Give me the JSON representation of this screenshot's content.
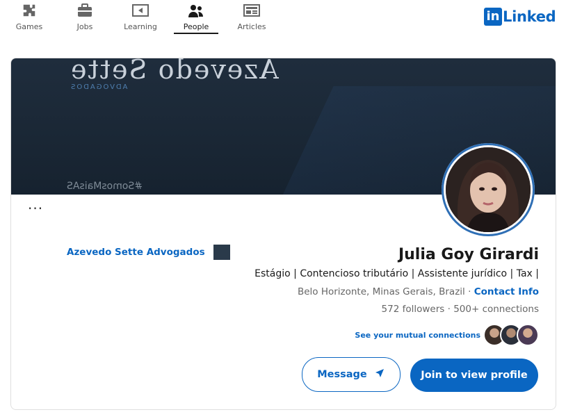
{
  "nav": {
    "items": [
      {
        "label": "Games",
        "icon": "puzzle-icon"
      },
      {
        "label": "Jobs",
        "icon": "briefcase-icon"
      },
      {
        "label": "Learning",
        "icon": "video-icon"
      },
      {
        "label": "People",
        "icon": "people-icon",
        "active": true
      },
      {
        "label": "Articles",
        "icon": "article-icon"
      }
    ],
    "logo_word": "Linked",
    "logo_box": "in"
  },
  "banner": {
    "title": "Azevedo Sette",
    "subtitle": "ADVOGADOS",
    "handle": "#SomosMaisAS"
  },
  "profile": {
    "name": "Julia Goy Girardi",
    "headline": "Estágio | Contencioso tributário | Assistente jurídico | Tax |",
    "location": "Belo Horizonte, Minas Gerais, Brazil",
    "contact_info": "Contact Info",
    "followers": "572 followers",
    "connections": "500+ connections",
    "mutual_connections": "See your mutual connections",
    "company": "Azevedo Sette Advogados",
    "more_label": "···"
  },
  "actions": {
    "primary": "Join to view profile",
    "secondary": "Message"
  },
  "colors": {
    "accent": "#0a66c2",
    "banner": "#1f2d3d"
  }
}
